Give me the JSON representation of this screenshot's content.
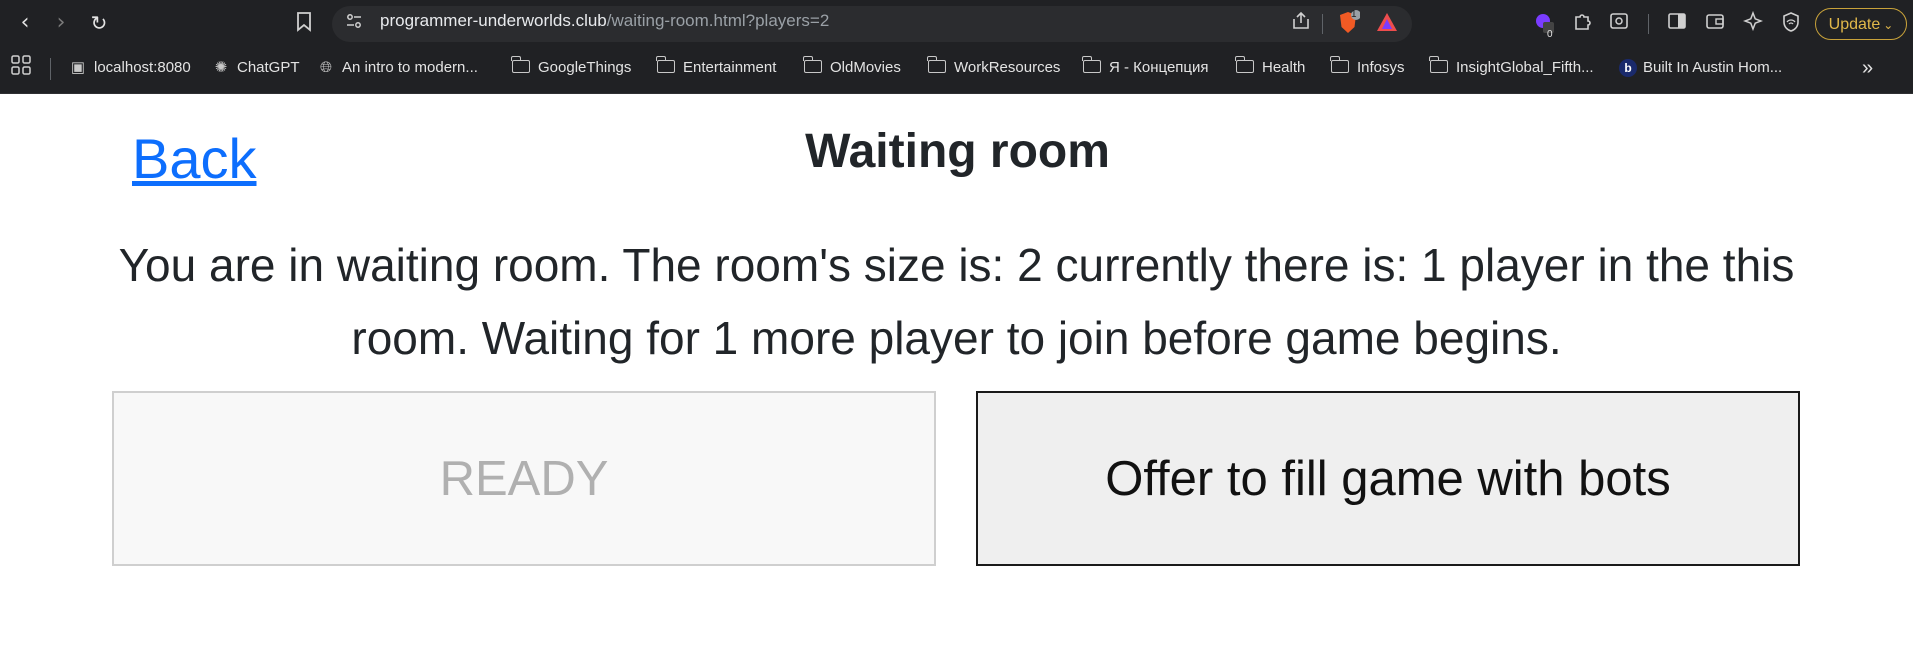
{
  "browser": {
    "url_host": "programmer-underworlds.club",
    "url_path": "/waiting-room.html?players=2",
    "brave_badge": "1",
    "extension_badge": "0",
    "update_label": "Update"
  },
  "bookmarks": [
    {
      "label": "localhost:8080",
      "icon": "page-icon"
    },
    {
      "label": "ChatGPT",
      "icon": "chatgpt-icon"
    },
    {
      "label": "An intro to modern...",
      "icon": "globe-icon"
    },
    {
      "label": "GoogleThings",
      "icon": "folder-icon"
    },
    {
      "label": "Entertainment",
      "icon": "folder-icon"
    },
    {
      "label": "OldMovies",
      "icon": "folder-icon"
    },
    {
      "label": "WorkResources",
      "icon": "folder-icon"
    },
    {
      "label": "Я - Концепция",
      "icon": "folder-icon"
    },
    {
      "label": "Health",
      "icon": "folder-icon"
    },
    {
      "label": "Infosys",
      "icon": "folder-icon"
    },
    {
      "label": "InsightGlobal_Fifth...",
      "icon": "folder-icon"
    },
    {
      "label": "Built In Austin Hom...",
      "icon": "builtin-icon"
    }
  ],
  "page": {
    "back_label": "Back",
    "title": "Waiting room",
    "message": "You are in waiting room. The room's size is: 2 currently there is: 1 player in the this room. Waiting for 1 more player to join before game begins.",
    "ready_label": "READY",
    "bots_label": "Offer to fill game with bots"
  },
  "colors": {
    "link": "#0d6efd",
    "chrome_bg": "#202124",
    "update_accent": "#c8a23a"
  }
}
